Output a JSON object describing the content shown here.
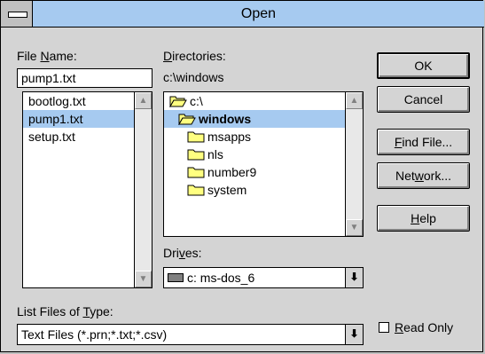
{
  "window": {
    "title": "Open"
  },
  "file_name": {
    "label_pre": "File ",
    "label_acc": "N",
    "label_post": "ame:",
    "value": "pump1.txt",
    "files": [
      "bootlog.txt",
      "pump1.txt",
      "setup.txt"
    ],
    "selected_index": 1
  },
  "directories": {
    "label_acc": "D",
    "label_post": "irectories:",
    "current_path": "c:\\windows",
    "items": [
      "c:\\",
      "windows",
      "msapps",
      "nls",
      "number9",
      "system"
    ],
    "selected_index": 1
  },
  "drives": {
    "label_pre": "Dri",
    "label_acc": "v",
    "label_post": "es:",
    "value": "c: ms-dos_6"
  },
  "file_type": {
    "label_pre": "List Files of ",
    "label_acc": "T",
    "label_post": "ype:",
    "value": "Text Files (*.prn;*.txt;*.csv)"
  },
  "buttons": {
    "ok": "OK",
    "cancel": "Cancel",
    "find_acc": "F",
    "find_post": "ind File...",
    "network_pre": "Net",
    "network_acc": "w",
    "network_post": "ork...",
    "help_acc": "H",
    "help_post": "elp"
  },
  "read_only": {
    "label_acc": "R",
    "label_post": "ead Only",
    "checked": false
  },
  "icons": {
    "system_menu": "system-menu-icon",
    "folder_open": "folder-open-icon",
    "folder_closed": "folder-icon",
    "drive": "drive-icon",
    "scroll_up": "scroll-up-arrow-icon",
    "scroll_down": "scroll-down-arrow-icon",
    "dropdown": "dropdown-arrow-icon"
  },
  "colors": {
    "title_bar": "#a6caf0",
    "selection": "#a6caf0",
    "dialog_face": "#d4d4d4",
    "folder_fill": "#ffff80"
  }
}
